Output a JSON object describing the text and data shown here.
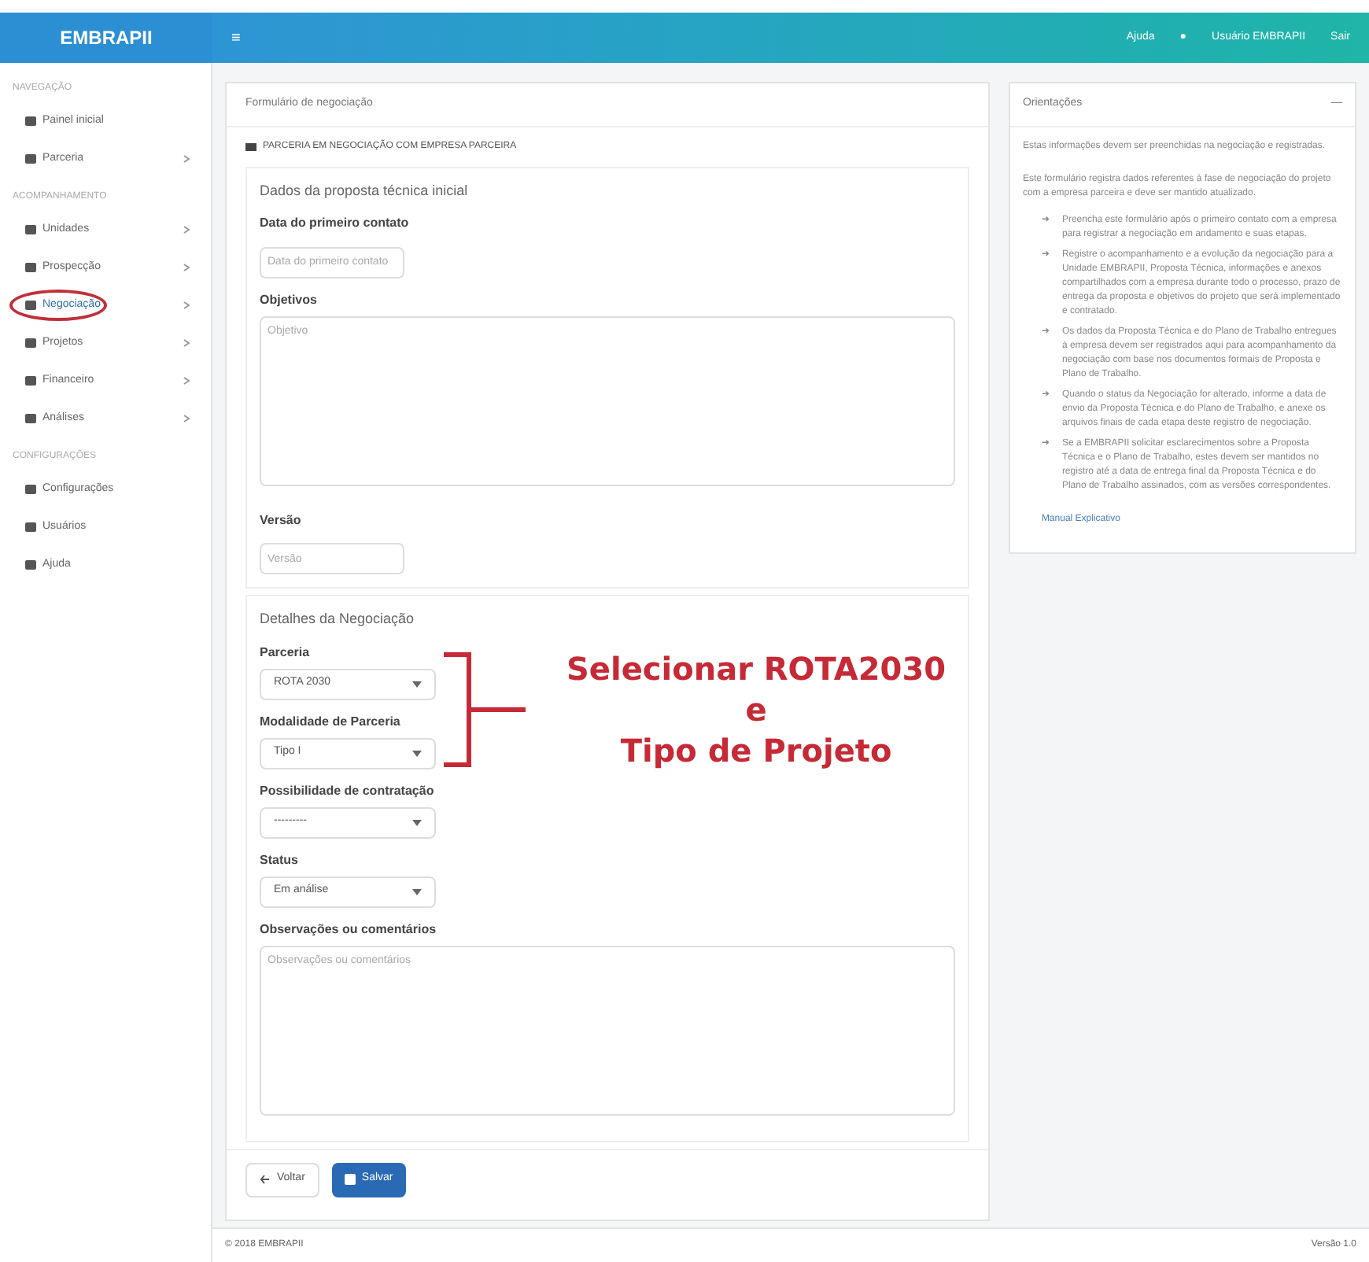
{
  "header": {
    "logo": "EMBRAPII",
    "menu_icon": "≡",
    "links": [
      {
        "label": "Ajuda"
      },
      {
        "label": "●"
      },
      {
        "label": "Usuário EMBRAPII"
      },
      {
        "label": "Sair"
      }
    ]
  },
  "sidebar": {
    "sections": [
      {
        "title": "NAVEGAÇÃO",
        "items": [
          {
            "label": "Painel inicial",
            "expandable": false,
            "selected": false
          },
          {
            "label": "Parceria",
            "expandable": true,
            "selected": false
          }
        ]
      },
      {
        "title": "ACOMPANHAMENTO",
        "items": [
          {
            "label": "Unidades",
            "expandable": true,
            "selected": false
          },
          {
            "label": "Prospecção",
            "expandable": true,
            "selected": false
          },
          {
            "label": "Negociação",
            "expandable": true,
            "selected": true
          },
          {
            "label": "Projetos",
            "expandable": true,
            "selected": false
          },
          {
            "label": "Financeiro",
            "expandable": true,
            "selected": false
          },
          {
            "label": "Análises",
            "expandable": true,
            "selected": false
          }
        ]
      },
      {
        "title": "CONFIGURAÇÕES",
        "items": [
          {
            "label": "Configurações",
            "expandable": false,
            "selected": false
          },
          {
            "label": "Usuários",
            "expandable": false,
            "selected": false
          },
          {
            "label": "Ajuda",
            "expandable": false,
            "selected": false
          }
        ]
      }
    ]
  },
  "form": {
    "title": "Formulário de negociação",
    "company": "PARCERIA EM NEGOCIAÇÃO COM EMPRESA PARCEIRA",
    "sections": [
      {
        "title": "Dados da proposta técnica inicial",
        "fields": [
          {
            "kind": "input",
            "label": "Data do primeiro contato",
            "placeholder": "Data do primeiro contato"
          },
          {
            "kind": "textarea",
            "label": "Objetivos",
            "placeholder": "Objetivo"
          },
          {
            "kind": "input",
            "label": "Versão",
            "placeholder": "Versão"
          }
        ]
      },
      {
        "title": "Detalhes da Negociação",
        "fields": [
          {
            "kind": "select",
            "label": "Parceria",
            "value": "ROTA 2030"
          },
          {
            "kind": "select",
            "label": "Modalidade de Parceria",
            "value": "Tipo I"
          },
          {
            "kind": "select",
            "label": "Possibilidade de contratação",
            "value": "---------"
          },
          {
            "kind": "select",
            "label": "Status",
            "value": "Em análise"
          },
          {
            "kind": "textarea",
            "label": "Observações ou comentários",
            "placeholder": "Observações ou comentários"
          }
        ]
      }
    ],
    "buttons": [
      {
        "label": "Voltar",
        "kind": "secondary"
      },
      {
        "label": "Salvar",
        "kind": "primary"
      }
    ]
  },
  "annotation": {
    "lines": [
      "Selecionar ROTA2030",
      "e",
      "Tipo de Projeto"
    ]
  },
  "guide": {
    "title": "Orientações",
    "collapse": "—",
    "intro": "Estas informações devem ser preenchidas na negociação e registradas.",
    "paragraph": "Este formulário registra dados referentes à fase de negociação do projeto com a empresa parceira e deve ser mantido atualizado.",
    "bullets": [
      "Preencha este formulário após o primeiro contato com a empresa para registrar a negociação em andamento e suas etapas.",
      "Registre o acompanhamento e a evolução da negociação para a Unidade EMBRAPII, Proposta Técnica, informações e anexos compartilhados com a empresa durante todo o processo, prazo de entrega da proposta e objetivos do projeto que será implementado e contratado.",
      "Os dados da Proposta Técnica e do Plano de Trabalho entregues à empresa devem ser registrados aqui para acompanhamento da negociação com base nos documentos formais de Proposta e Plano de Trabalho.",
      "Quando o status da Negociação for alterado, informe a data de envio da Proposta Técnica e do Plano de Trabalho, e anexe os arquivos finais de cada etapa deste registro de negociação.",
      "Se a EMBRAPII solicitar esclarecimentos sobre a Proposta Técnica e o Plano de Trabalho, estes devem ser mantidos no registro até a data de entrega final da Proposta Técnica e do Plano de Trabalho assinados, com as versões correspondentes."
    ],
    "bullet_icon": "➜",
    "link": "Manual Explicativo"
  },
  "footer": {
    "left": "© 2018 EMBRAPII",
    "right": "Versão 1.0"
  }
}
